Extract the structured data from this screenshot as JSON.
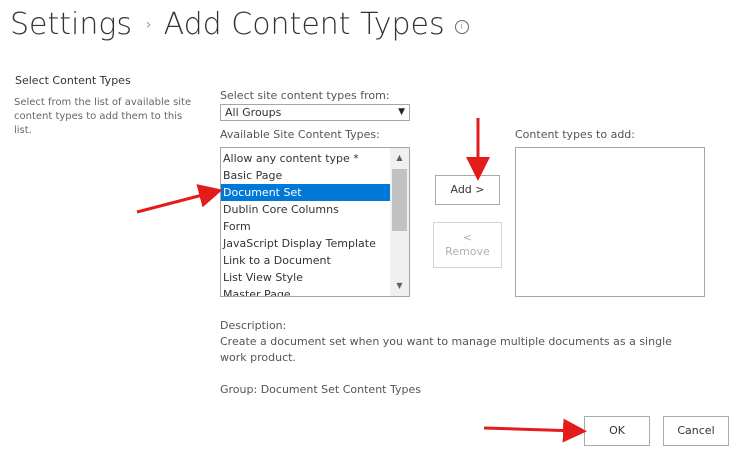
{
  "header": {
    "crumb_root": "Settings",
    "crumb_sep": "›",
    "title": "Add Content Types",
    "info_icon": "i"
  },
  "section": {
    "title": "Select Content Types",
    "description": "Select from the list of available site content types to add them to this list."
  },
  "source": {
    "label": "Select site content types from:",
    "selected": "All Groups",
    "arrow": "▼"
  },
  "available": {
    "label": "Available Site Content Types:",
    "items": [
      "Allow any content type *",
      "Basic Page",
      "Document Set",
      "Dublin Core Columns",
      "Form",
      "JavaScript Display Template",
      "Link to a Document",
      "List View Style",
      "Master Page"
    ],
    "selected_index": 2,
    "scroll_up": "▲",
    "scroll_down": "▼"
  },
  "buttons": {
    "add": "Add >",
    "remove_arrow": "<",
    "remove": "Remove",
    "ok": "OK",
    "cancel": "Cancel"
  },
  "to_add": {
    "label": "Content types to add:"
  },
  "description": {
    "label": "Description:",
    "text": "Create a document set when you want to manage multiple documents as a single work product.",
    "group": "Group: Document Set Content Types"
  },
  "annotation": {
    "arrow_color": "#e31b1b"
  }
}
